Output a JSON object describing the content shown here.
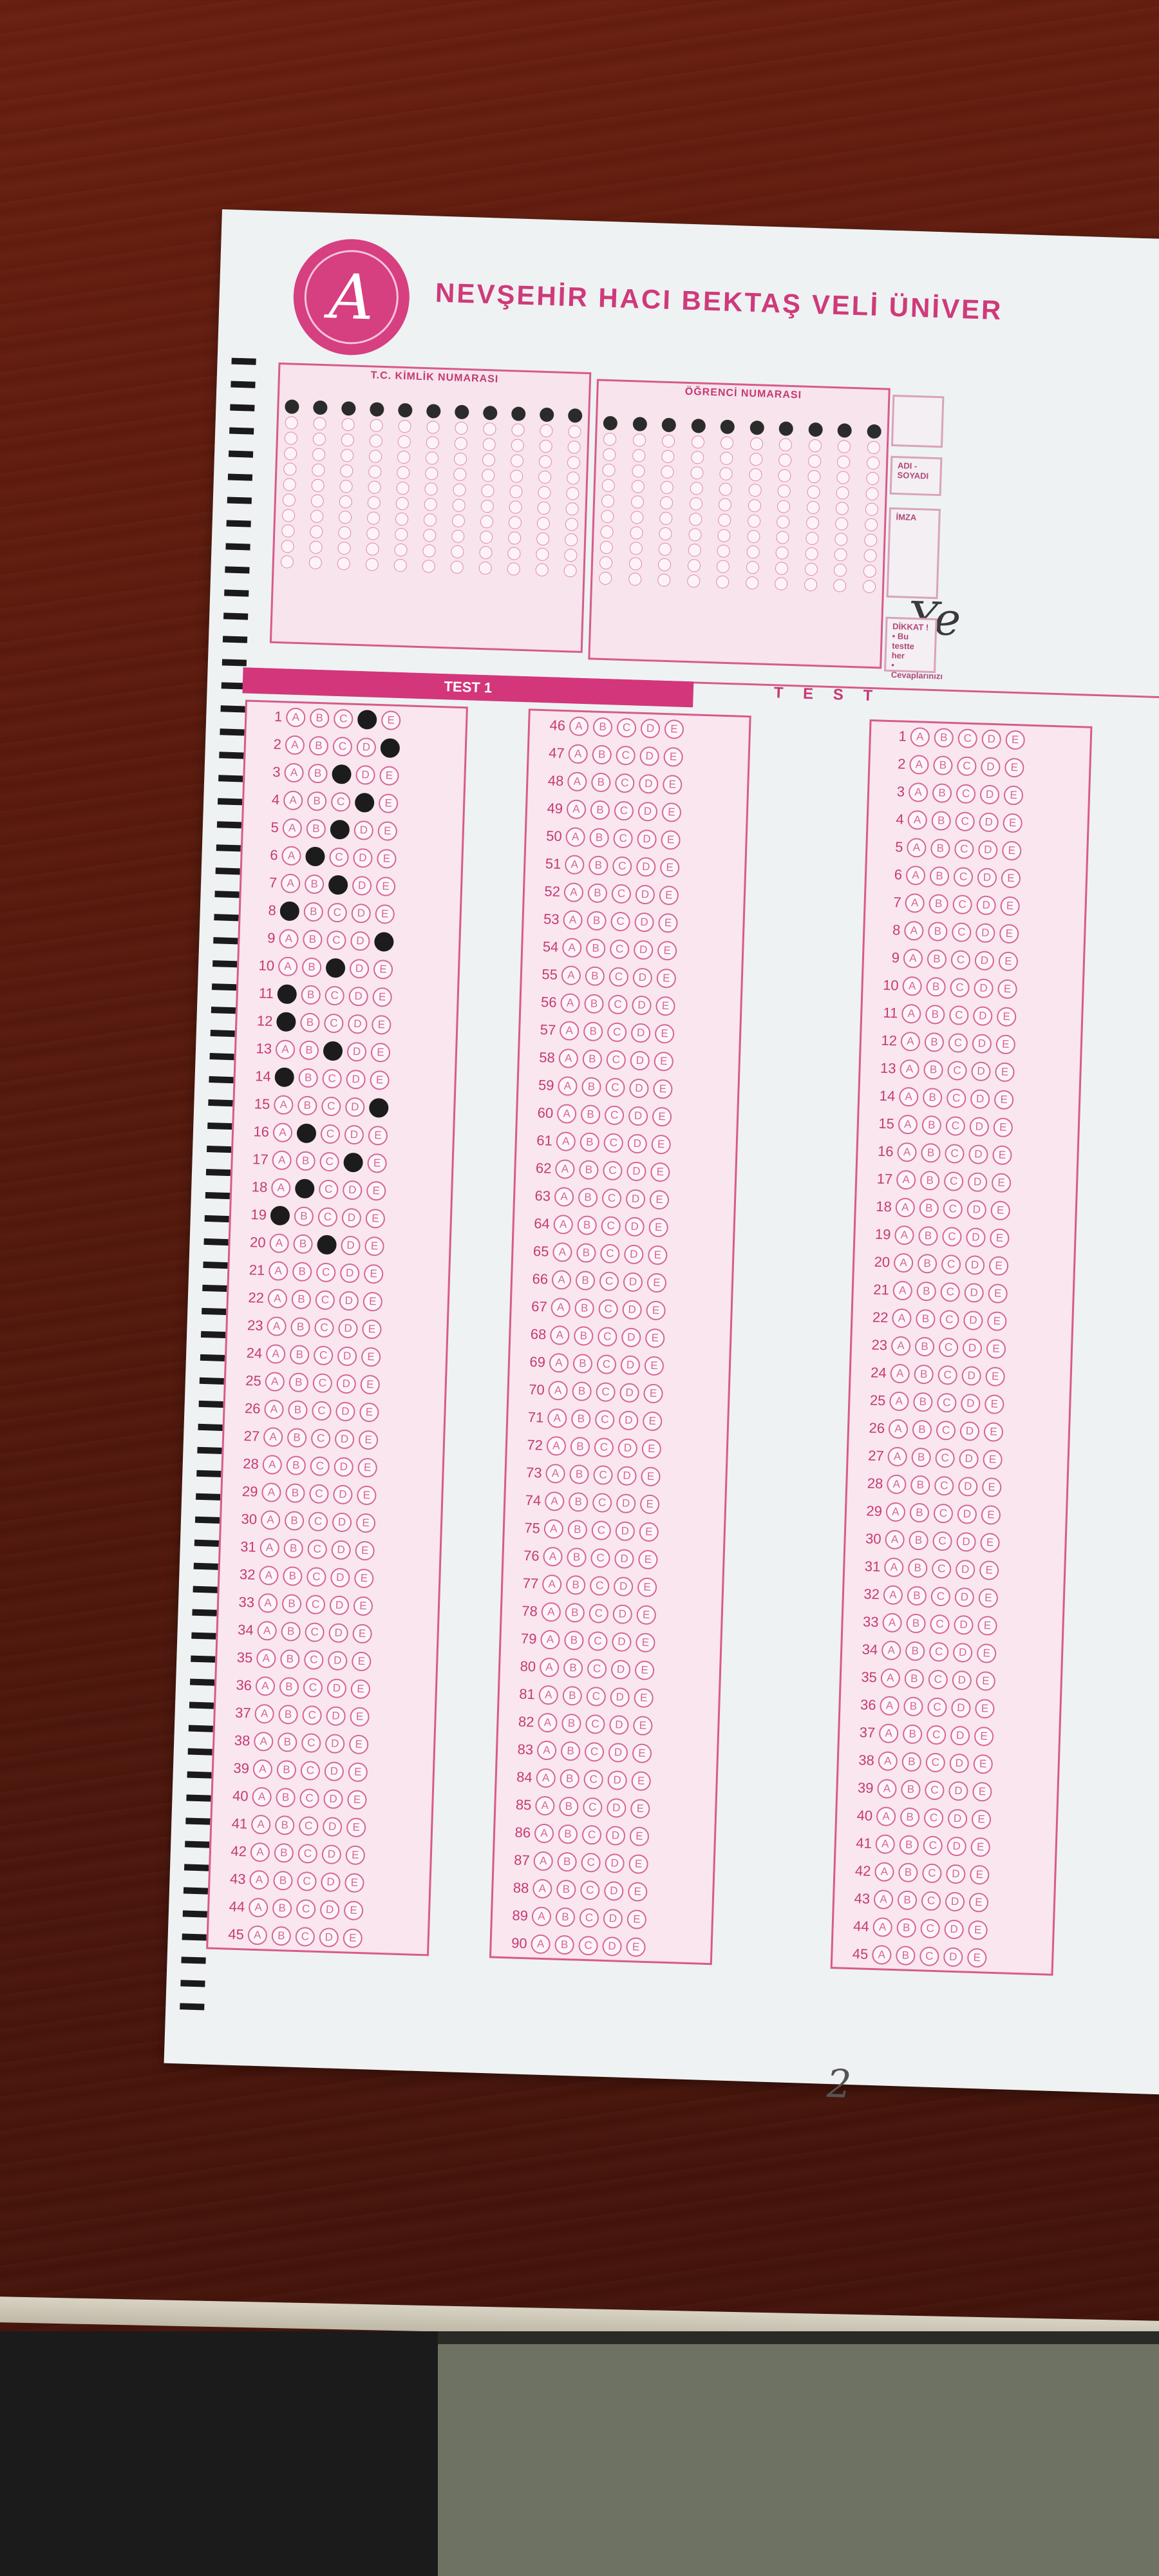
{
  "header": {
    "logo_letter": "A",
    "university_title": "NEVŞEHİR HACI BEKTAŞ VELİ ÜNİVER"
  },
  "id_fields": {
    "tc_label": "T.C. KİMLİK NUMARASI",
    "student_label": "ÖĞRENCİ NUMARASI",
    "name_label": "ADI - SOYADI",
    "signature_label": "İMZA",
    "attention_label": "DİKKAT !",
    "attention_lines": [
      "• Bu testte her",
      "• Cevaplarınızı"
    ],
    "signature_text": "Ye"
  },
  "test": {
    "test1_label": "TEST 1",
    "test_word": "T E S T",
    "options": [
      "A",
      "B",
      "C",
      "D",
      "E"
    ],
    "col1_start": 1,
    "col2_start": 46,
    "col3_start": 1,
    "answers_col1": [
      "D",
      "E",
      "C",
      "D",
      "C",
      "B",
      "C",
      "A",
      "E",
      "C",
      "A",
      "A",
      "C",
      "A",
      "E",
      "B",
      "D",
      "B",
      "A",
      "C"
    ],
    "handwritten_page": "2"
  }
}
